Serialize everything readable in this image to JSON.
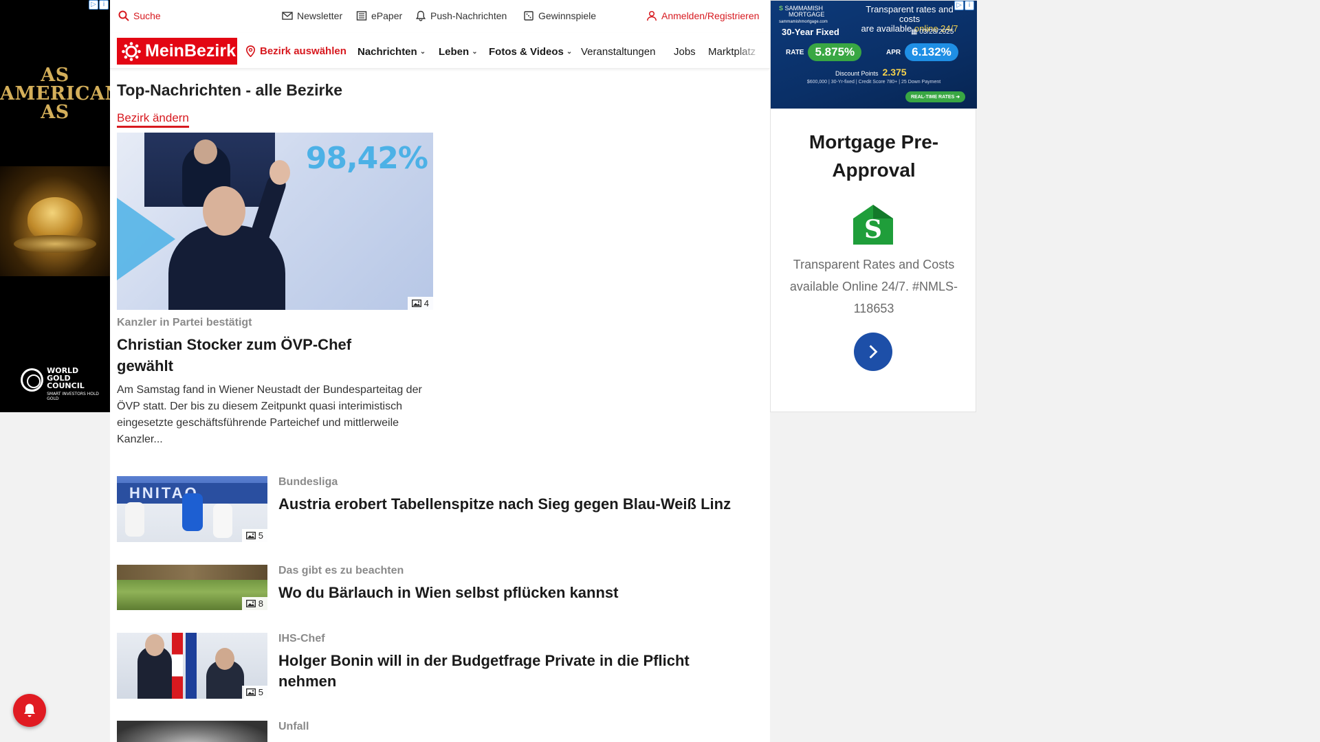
{
  "colors": {
    "brand_red": "#e30613",
    "link_red": "#d7191f",
    "navy": "#1d4fa8"
  },
  "left_ad": {
    "headline": "AS AMERICAN AS",
    "brand_name": "WORLD GOLD COUNCIL",
    "brand_tagline": "SMART INVESTORS HOLD GOLD"
  },
  "utility_bar": {
    "search": "Suche",
    "newsletter": "Newsletter",
    "epaper": "ePaper",
    "push": "Push-Nachrichten",
    "gewinnspiele": "Gewinnspiele",
    "login": "Anmelden/Registrieren"
  },
  "nav": {
    "logo": "MeinBezirk",
    "bezirk": "Bezirk auswählen",
    "items": [
      "Nachrichten",
      "Leben",
      "Fotos & Videos",
      "Veranstaltungen",
      "Jobs",
      "Marktplatz"
    ]
  },
  "page": {
    "title": "Top-Nachrichten - alle Bezirke",
    "change_link": "Bezirk ändern"
  },
  "top_article": {
    "image_overlay_text": "98,42%",
    "photo_count": "4",
    "kicker": "Kanzler in Partei bestätigt",
    "title": "Christian Stocker zum ÖVP-Chef gewählt",
    "teaser": "Am Samstag fand in Wiener Neustadt der Bundesparteitag der ÖVP statt. Der bis zu diesem Zeitpunkt quasi interimistisch eingesetzte geschäftsführende Parteichef und mittlerweile Kanzler..."
  },
  "articles": [
    {
      "kicker": "Bundesliga",
      "title": "Austria erobert Tabellenspitze nach Sieg gegen Blau-Weiß Linz",
      "photo_count": "5"
    },
    {
      "kicker": "Das gibt es zu beachten",
      "title": "Wo du Bärlauch in Wien selbst pflücken kannst",
      "photo_count": "8"
    },
    {
      "kicker": "IHS-Chef",
      "title": "Holger Bonin will in der Budgetfrage Private in die Pflicht nehmen",
      "photo_count": "5"
    },
    {
      "kicker": "Unfall",
      "title": ""
    }
  ],
  "right_ad": {
    "banner": {
      "logo_line1": "SAMMAMISH",
      "logo_line2": "MORTGAGE",
      "logo_url": "sammamishmortgage.com",
      "promo_line1": "Transparent rates and costs",
      "promo_line2": "are available",
      "promo_highlight": "online 24/7",
      "product": "30-Year Fixed",
      "date": "03/28/2025",
      "rate_label": "RATE",
      "rate": "5.875%",
      "apr_label": "APR",
      "apr": "6.132%",
      "points_label": "Discount Points",
      "points": "2.375",
      "fine_print": "$600,000 | 30-Yr-fixed | Credit Score 780+ | 25 Down Payment",
      "cta": "REAL-TIME RATES"
    },
    "title": "Mortgage Pre-Approval",
    "house_letter": "S",
    "text": "Transparent Rates and Costs available Online 24/7. #NMLS-118653",
    "button_icon": "chevron-right-icon"
  }
}
